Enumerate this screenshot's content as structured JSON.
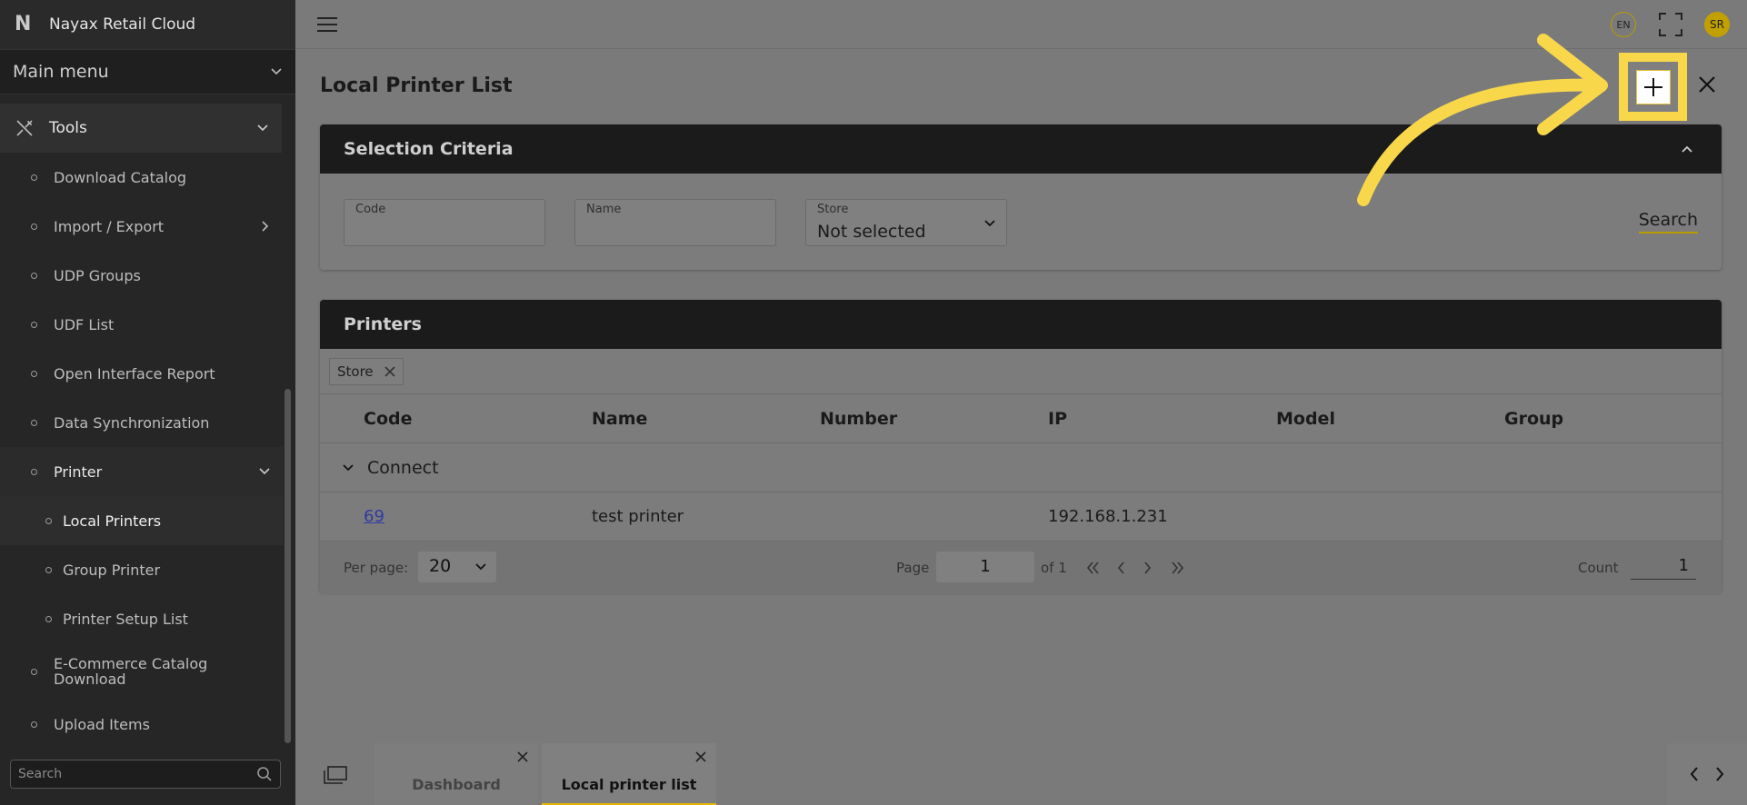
{
  "app": {
    "title": "Nayax Retail Cloud"
  },
  "sidebar": {
    "main_menu_label": "Main menu",
    "section_label": "Tools",
    "items": [
      {
        "label": "Download Catalog"
      },
      {
        "label": "Import / Export"
      },
      {
        "label": "UDP Groups"
      },
      {
        "label": "UDF List"
      },
      {
        "label": "Open Interface Report"
      },
      {
        "label": "Data Synchronization"
      },
      {
        "label": "Printer"
      },
      {
        "label": "E-Commerce Catalog Download"
      },
      {
        "label": "Upload Items"
      }
    ],
    "printer_children": [
      {
        "label": "Local Printers"
      },
      {
        "label": "Group Printer"
      },
      {
        "label": "Printer Setup List"
      }
    ],
    "search_placeholder": "Search"
  },
  "topbar": {
    "language": "EN",
    "avatar_initials": "SR"
  },
  "page": {
    "title": "Local Printer List"
  },
  "criteria": {
    "title": "Selection Criteria",
    "code_label": "Code",
    "name_label": "Name",
    "store_label": "Store",
    "store_value": "Not selected",
    "search_label": "Search"
  },
  "printers": {
    "title": "Printers",
    "group_chip": "Store",
    "columns": [
      "Code",
      "Name",
      "Number",
      "IP",
      "Model",
      "Group"
    ],
    "group_row": "Connect",
    "rows": [
      {
        "code": "69",
        "name": "test printer",
        "number": "",
        "ip": "192.168.1.231",
        "model": "",
        "group": ""
      }
    ]
  },
  "pager": {
    "per_page_label": "Per page:",
    "per_page_value": "20",
    "page_label": "Page",
    "page_value": "1",
    "of_label": "of 1",
    "count_label": "Count",
    "count_value": "1"
  },
  "tabs": [
    {
      "label": "Dashboard"
    },
    {
      "label": "Local printer list"
    }
  ],
  "colors": {
    "accent": "#f8d74a",
    "sidebar_bg": "#262626",
    "header_bg": "#1b1b1b"
  }
}
